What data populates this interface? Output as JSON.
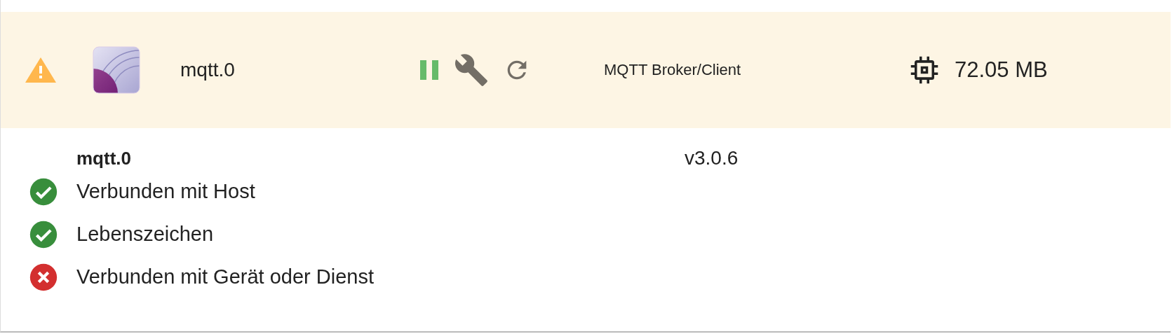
{
  "adapter": {
    "name": "mqtt.0",
    "title": "MQTT Broker/Client",
    "memory": "72.05 MB"
  },
  "details": {
    "name": "mqtt.0",
    "version": "v3.0.6",
    "status": [
      {
        "label": "Verbunden mit Host",
        "ok": true
      },
      {
        "label": "Lebenszeichen",
        "ok": true
      },
      {
        "label": "Verbunden mit Gerät oder Dienst",
        "ok": false
      }
    ]
  }
}
